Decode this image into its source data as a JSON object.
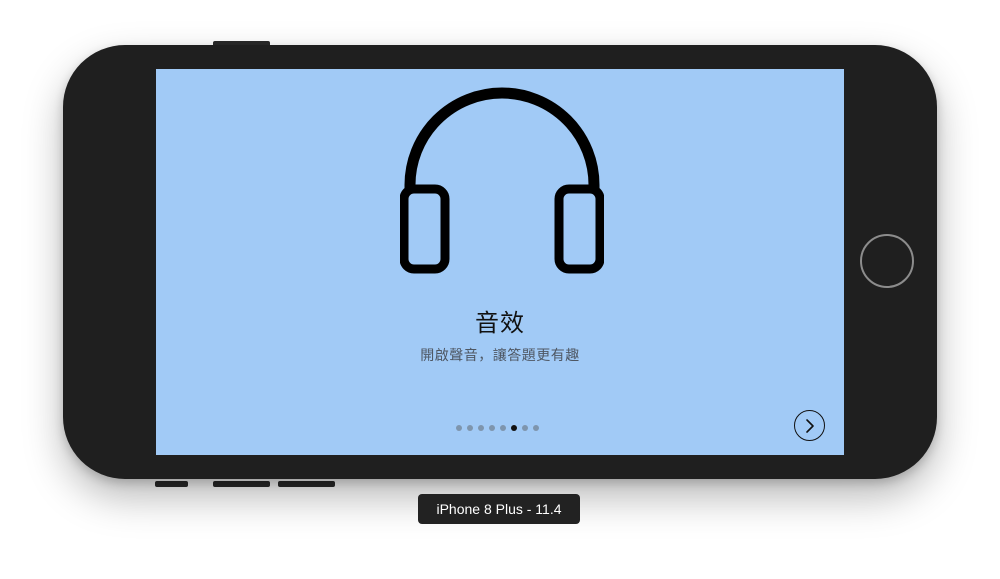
{
  "onboarding": {
    "title": "音效",
    "subtitle": "開啟聲音，讓答題更有趣",
    "icon": "headphones-icon",
    "page_indicator": {
      "total": 8,
      "current": 6
    },
    "next_icon": "chevron-right-icon"
  },
  "simulator": {
    "device_label": "iPhone 8 Plus - 11.4"
  },
  "colors": {
    "screen_background": "#a1caf6",
    "device_body": "#1f1f1f",
    "text_primary": "#111111",
    "text_secondary": "#4e5763"
  }
}
